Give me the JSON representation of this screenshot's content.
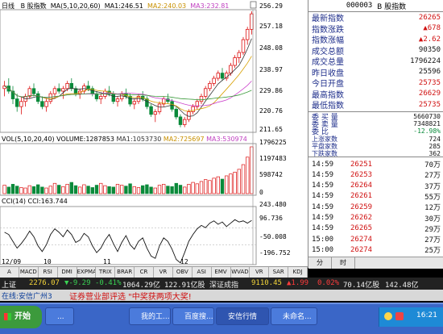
{
  "header": {
    "period": "日线",
    "stock": "B 股指数",
    "ma_label": "MA(5,10,20,60)",
    "ma1": "MA1:246.51",
    "ma2": "MA2:240.03",
    "ma3": "MA3:232.81"
  },
  "price_axis": [
    "256.29",
    "257.18",
    "248.08",
    "238.97",
    "229.86",
    "220.76",
    "211.65"
  ],
  "volume_header": {
    "label": "VOL(5,10,20,40)",
    "volume": "VOLUME:1287853",
    "v1": "MA1:1053730",
    "v2": "MA2:725697",
    "v3": "MA3:530974"
  },
  "volume_axis": [
    "1796225",
    "1197483",
    "598742",
    "0"
  ],
  "cci_header": {
    "label": "CCI(14)",
    "value": "CCI:163.744"
  },
  "cci_axis": [
    "243.480",
    "96.736",
    "-50.008",
    "-196.752"
  ],
  "date_axis": [
    "12/09",
    "10",
    "11",
    "12"
  ],
  "candles": [
    [
      228,
      231,
      225,
      229
    ],
    [
      229,
      232,
      226,
      227
    ],
    [
      227,
      229,
      222,
      224
    ],
    [
      224,
      226,
      219,
      221
    ],
    [
      221,
      225,
      218,
      223
    ],
    [
      223,
      226,
      221,
      225
    ],
    [
      225,
      229,
      224,
      228
    ],
    [
      228,
      230,
      225,
      226
    ],
    [
      226,
      227,
      222,
      223
    ],
    [
      223,
      225,
      220,
      221
    ],
    [
      221,
      224,
      219,
      223
    ],
    [
      223,
      227,
      222,
      226
    ],
    [
      226,
      229,
      224,
      228
    ],
    [
      228,
      230,
      226,
      227
    ],
    [
      227,
      229,
      224,
      228
    ],
    [
      228,
      231,
      227,
      230
    ],
    [
      230,
      232,
      227,
      228
    ],
    [
      228,
      229,
      225,
      226
    ],
    [
      226,
      228,
      224,
      227
    ],
    [
      227,
      230,
      226,
      229
    ],
    [
      229,
      231,
      227,
      228
    ],
    [
      228,
      229,
      225,
      226
    ],
    [
      226,
      227,
      223,
      224
    ],
    [
      224,
      226,
      222,
      225
    ],
    [
      225,
      228,
      224,
      227
    ],
    [
      227,
      229,
      225,
      226
    ],
    [
      226,
      227,
      222,
      223
    ],
    [
      223,
      225,
      221,
      224
    ],
    [
      224,
      227,
      223,
      226
    ],
    [
      226,
      228,
      224,
      225
    ],
    [
      225,
      226,
      221,
      222
    ],
    [
      222,
      224,
      220,
      223
    ],
    [
      223,
      226,
      222,
      225
    ],
    [
      225,
      227,
      223,
      224
    ],
    [
      224,
      225,
      220,
      221
    ],
    [
      221,
      222,
      217,
      218
    ],
    [
      218,
      220,
      215,
      219
    ],
    [
      219,
      223,
      218,
      222
    ],
    [
      222,
      225,
      221,
      224
    ],
    [
      224,
      226,
      222,
      223
    ],
    [
      223,
      224,
      219,
      220
    ],
    [
      220,
      221,
      216,
      217
    ],
    [
      217,
      218,
      213,
      214
    ],
    [
      214,
      217,
      213,
      216
    ],
    [
      216,
      220,
      215,
      219
    ],
    [
      219,
      222,
      218,
      221
    ],
    [
      221,
      224,
      220,
      223
    ],
    [
      223,
      226,
      222,
      225
    ],
    [
      225,
      229,
      224,
      228
    ],
    [
      228,
      231,
      227,
      230
    ],
    [
      230,
      233,
      229,
      232
    ],
    [
      232,
      235,
      231,
      234
    ],
    [
      234,
      236,
      231,
      232
    ],
    [
      232,
      235,
      231,
      234
    ],
    [
      234,
      238,
      233,
      237
    ],
    [
      237,
      241,
      236,
      240
    ],
    [
      240,
      243,
      238,
      242
    ],
    [
      242,
      248,
      241,
      247
    ],
    [
      247,
      252,
      245,
      251
    ],
    [
      251,
      258,
      249,
      257
    ]
  ],
  "volumes": [
    0.18,
    0.14,
    0.2,
    0.16,
    0.13,
    0.12,
    0.17,
    0.15,
    0.19,
    0.14,
    0.12,
    0.16,
    0.22,
    0.18,
    0.15,
    0.2,
    0.24,
    0.17,
    0.14,
    0.19,
    0.16,
    0.13,
    0.18,
    0.22,
    0.17,
    0.15,
    0.14,
    0.2,
    0.18,
    0.16,
    0.21,
    0.15,
    0.13,
    0.17,
    0.19,
    0.14,
    0.12,
    0.18,
    0.2,
    0.16,
    0.15,
    0.22,
    0.18,
    0.14,
    0.2,
    0.24,
    0.21,
    0.26,
    0.3,
    0.28,
    0.33,
    0.36,
    0.31,
    0.38,
    0.42,
    0.46,
    0.52,
    0.62,
    0.78,
    1.0
  ],
  "cci_points": [
    60,
    40,
    -20,
    -80,
    -40,
    10,
    70,
    20,
    -60,
    -110,
    -50,
    40,
    90,
    60,
    20,
    80,
    40,
    -30,
    -10,
    50,
    20,
    -60,
    -120,
    -80,
    -10,
    40,
    -40,
    -110,
    -30,
    30,
    -50,
    -90,
    -20,
    10,
    -80,
    -150,
    -170,
    -60,
    10,
    -20,
    -90,
    -180,
    -210,
    -120,
    -20,
    40,
    90,
    120,
    100,
    140,
    160,
    130,
    150,
    110,
    140,
    170,
    150,
    160,
    140,
    164
  ],
  "quote": {
    "code": "000003",
    "name": "B 股指数",
    "rows": [
      {
        "k": "最新指数",
        "v": "26265",
        "c": "red"
      },
      {
        "k": "指数涨跌",
        "v": "▲678",
        "c": "red"
      },
      {
        "k": "指数涨幅",
        "v": "▲2.62",
        "c": "red"
      },
      {
        "k": "成交总额",
        "v": "90350",
        "c": "dark"
      },
      {
        "k": "成交总量",
        "v": "1796224",
        "c": "dark"
      },
      {
        "k": "昨日收盘",
        "v": "25596",
        "c": "dark"
      },
      {
        "k": "今日开盘",
        "v": "25735",
        "c": "red"
      },
      {
        "k": "最高指数",
        "v": "26629",
        "c": "red"
      },
      {
        "k": "最低指数",
        "v": "25735",
        "c": "red"
      }
    ],
    "stats": [
      {
        "k": "委 买 量",
        "v": "5660730"
      },
      {
        "k": "委 卖 量",
        "v": "7348821"
      },
      {
        "k": "委 比",
        "v": "-12.98%"
      },
      {
        "k": "上涨家数",
        "v": "724"
      },
      {
        "k": "平盘家数",
        "v": "285"
      },
      {
        "k": "下跌家数",
        "v": "362"
      }
    ],
    "trades": [
      {
        "t": "14:59",
        "p": "26251",
        "q": "70万"
      },
      {
        "t": "14:59",
        "p": "26253",
        "q": "27万"
      },
      {
        "t": "14:59",
        "p": "26264",
        "q": "37万"
      },
      {
        "t": "14:59",
        "p": "26261",
        "q": "55万"
      },
      {
        "t": "14:59",
        "p": "26259",
        "q": "12万"
      },
      {
        "t": "14:59",
        "p": "26262",
        "q": "30万"
      },
      {
        "t": "14:59",
        "p": "26265",
        "q": "29万"
      },
      {
        "t": "15:00",
        "p": "26274",
        "q": "27万"
      },
      {
        "t": "15:00",
        "p": "26274",
        "q": "25万"
      }
    ],
    "tabs": [
      "分",
      "时"
    ]
  },
  "tabs": [
    "A",
    "MACD",
    "RSI",
    "DMI",
    "EXPMA",
    "TRIX",
    "BRAR",
    "CR",
    "VR",
    "OBV",
    "ASI",
    "EMV",
    "WVAD",
    "VR",
    "SAR",
    "KDJ"
  ],
  "status": {
    "left": "上证",
    "index": "2276.07",
    "chg": "▼-9.29",
    "pct": "-0.41%",
    "amt": "1064.29亿",
    "b": "122.91亿股",
    "label": "深证成指",
    "sz_index": "9110.45",
    "sz_chg": "▲1.99",
    "sz_pct": "0.02%",
    "sz_amt": "70.14亿股",
    "sz_b": "142.48亿"
  },
  "marquee": {
    "left": "在线:安信广州3",
    "text": "证券营业部评选 \"中奖获两项大奖!"
  },
  "taskbar": {
    "start": "开始",
    "buttons": [
      "...",
      "我的工...",
      "百度搜...",
      "安信行情",
      "未命名...",
      ""
    ],
    "clock": "16:21"
  },
  "colors": {
    "up": "#d11",
    "down": "#0a8a3a",
    "ma1": "#333",
    "ma2": "#d8a000",
    "ma3": "#cc44cc",
    "ma4": "#3a9a3a"
  }
}
